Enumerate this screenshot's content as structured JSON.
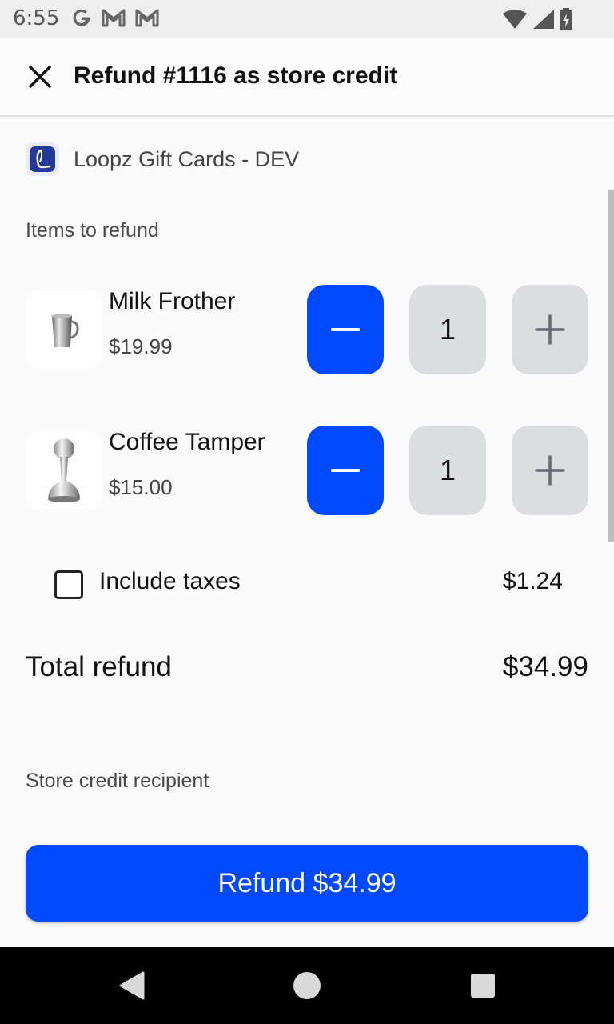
{
  "status_bar": {
    "time": "6:55",
    "left_icons": [
      "google-icon",
      "gmail-icon",
      "gmail-icon"
    ],
    "right_icons": [
      "wifi-icon",
      "signal-icon",
      "battery-icon"
    ]
  },
  "app_bar": {
    "close_icon": "close-icon",
    "title": "Refund #1116 as store credit"
  },
  "store": {
    "logo_icon": "loopz-logo-icon",
    "name": "Loopz Gift Cards - DEV"
  },
  "items_section": {
    "label": "Items to refund",
    "items": [
      {
        "name": "Milk Frother",
        "price": "$19.99",
        "quantity": "1",
        "image_icon": "milk-frother-image"
      },
      {
        "name": "Coffee Tamper",
        "price": "$15.00",
        "quantity": "1",
        "image_icon": "coffee-tamper-image"
      }
    ]
  },
  "taxes": {
    "checked": false,
    "label": "Include taxes",
    "amount": "$1.24"
  },
  "total": {
    "label": "Total refund",
    "amount": "$34.99"
  },
  "recipient": {
    "label": "Store credit recipient"
  },
  "refund_button": {
    "label": "Refund $34.99"
  },
  "nav_bar": {
    "icons": [
      "back-icon",
      "home-icon",
      "recents-icon"
    ]
  },
  "colors": {
    "accent": "#0049ff",
    "stepper_gray": "#dcdde1",
    "background": "#fafafa"
  }
}
